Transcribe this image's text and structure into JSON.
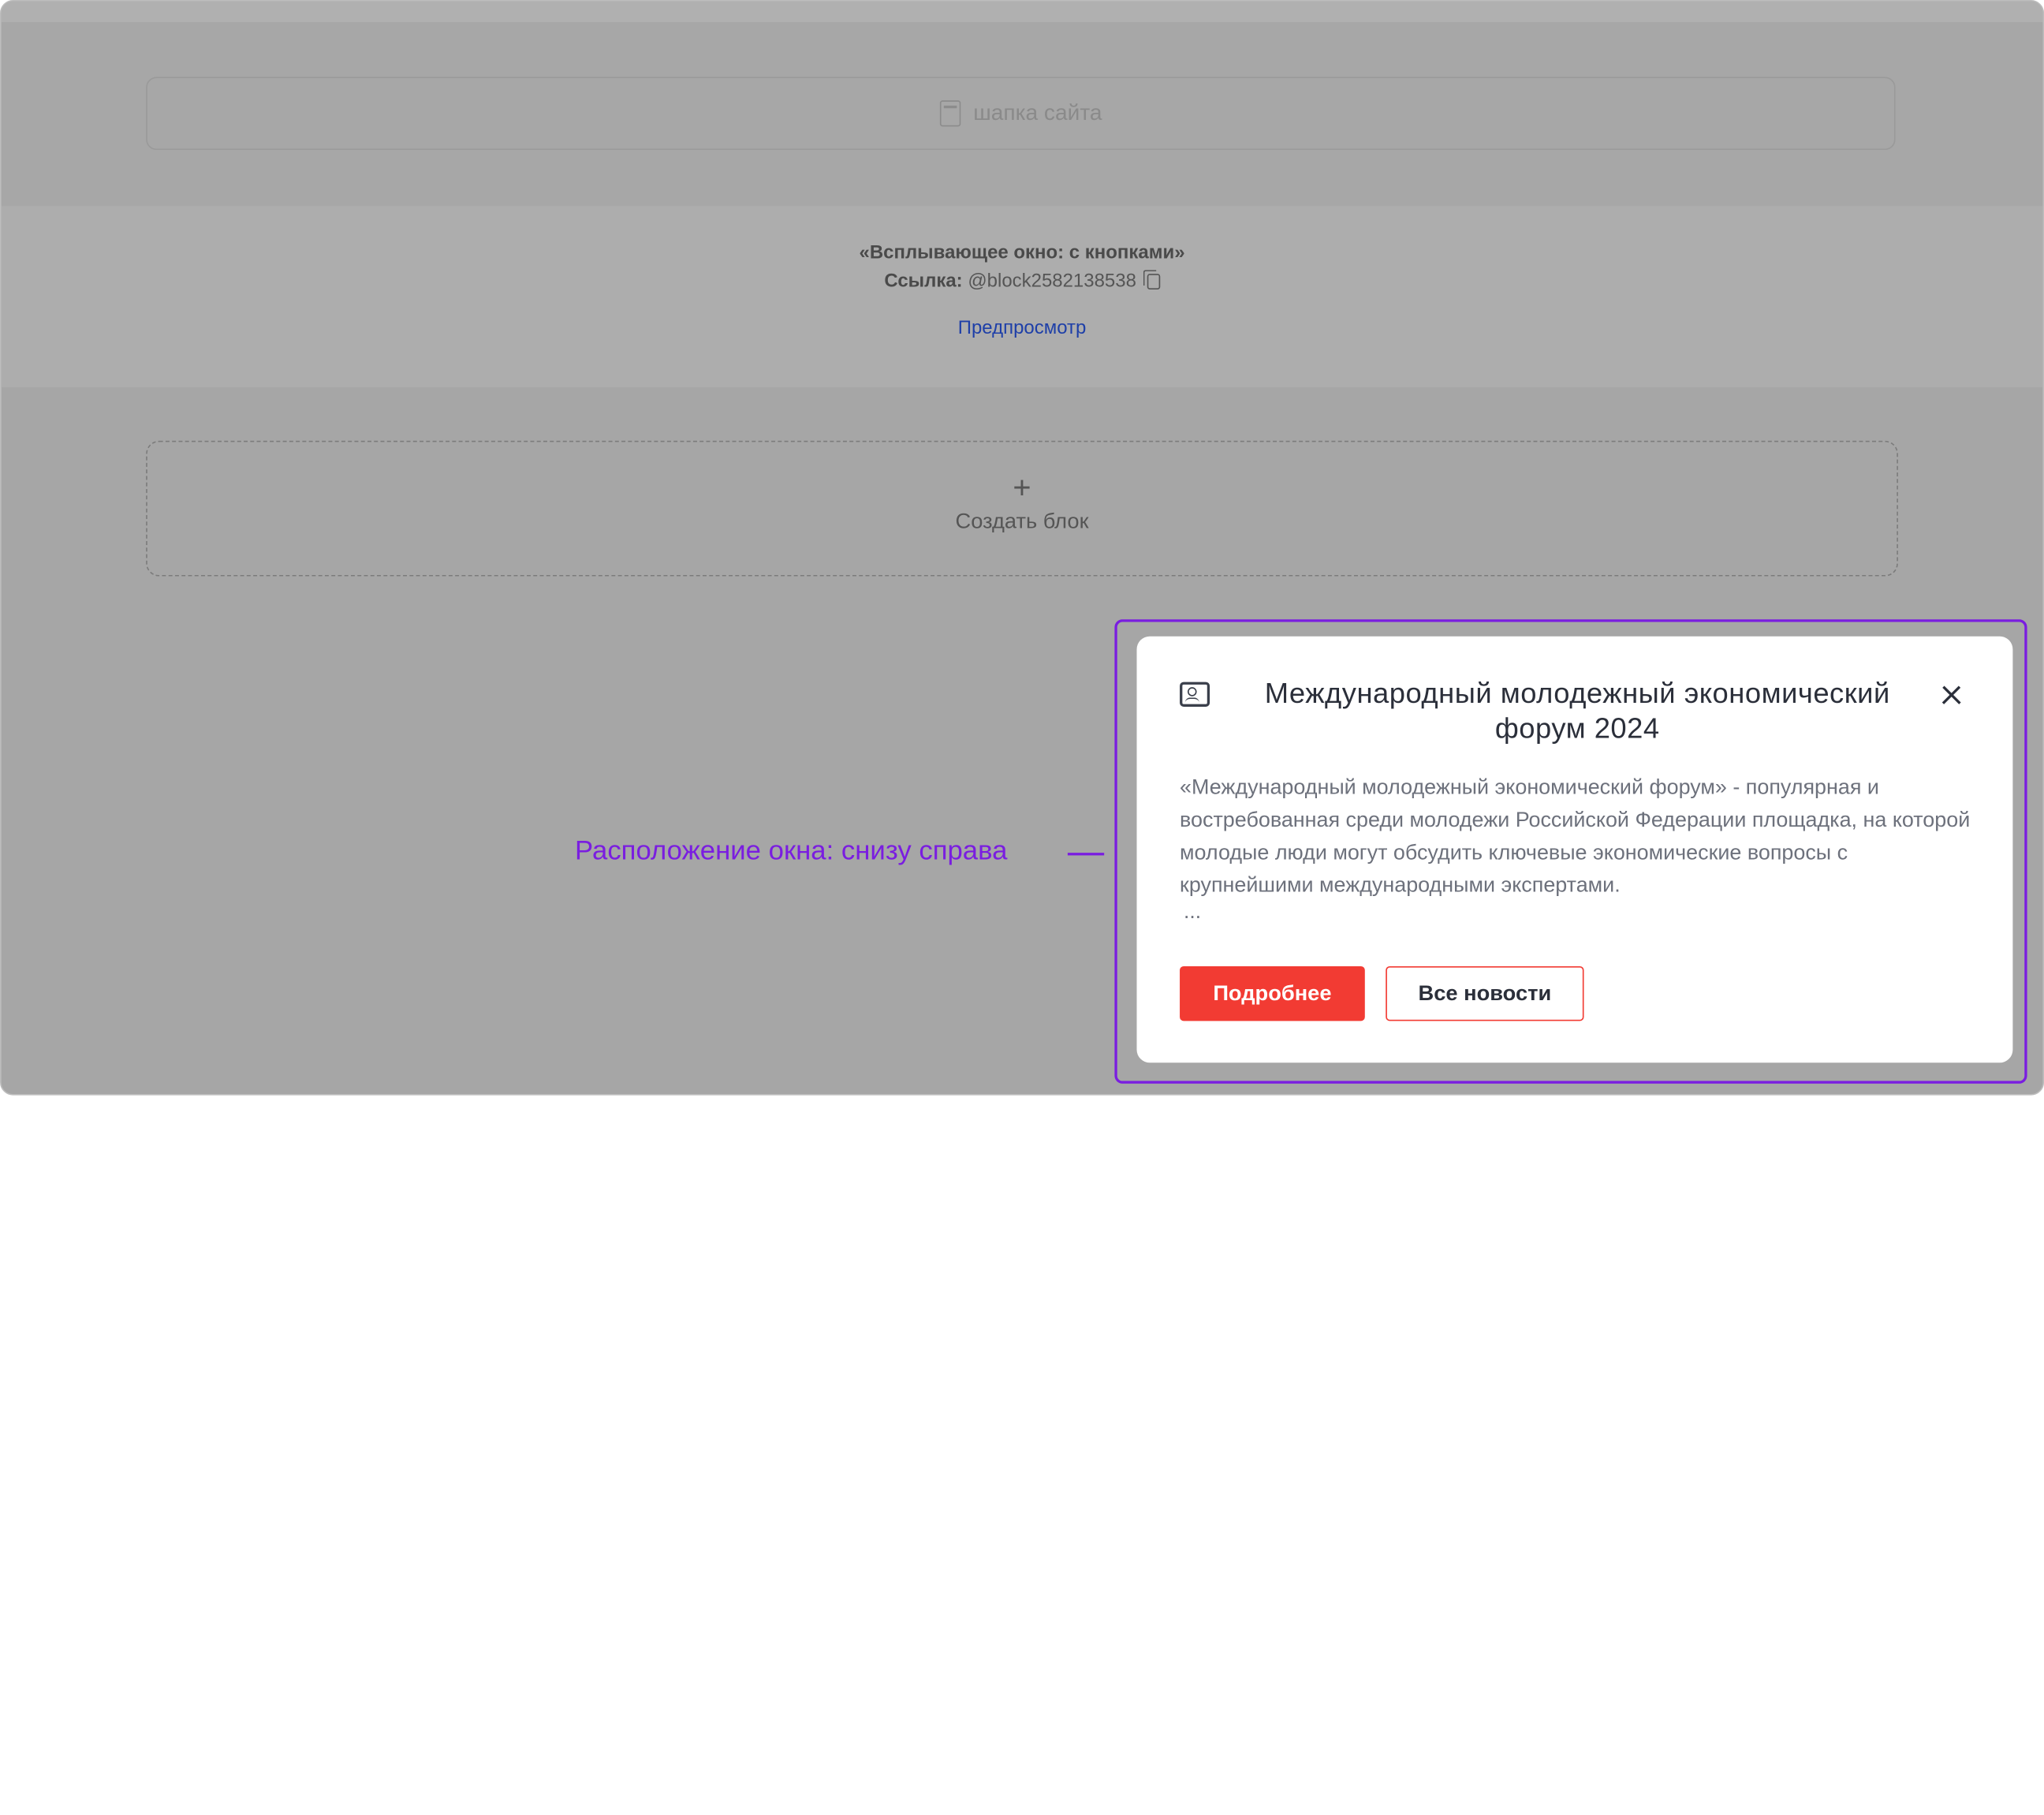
{
  "header_placeholder": {
    "label": "шапка сайта",
    "icon": "page-icon"
  },
  "block_info": {
    "title": "«Всплывающее окно: с кнопками»",
    "link_label": "Ссылка:",
    "link_value": "@block2582138538",
    "copy_icon": "copy-icon",
    "preview_label": "Предпросмотр"
  },
  "create_block": {
    "plus": "+",
    "label": "Создать блок"
  },
  "annotation": {
    "text": "Расположение окна: снизу справа",
    "color": "#7a1de0"
  },
  "popup": {
    "icon": "id-card-icon",
    "title": "Международный молодежный экономический форум 2024",
    "body": "«Международный молодежный экономический форум» - популярная и востребованная среди молодежи Российской Федерации площадка, на которой молодые люди могут обсудить ключевые экономические вопросы с крупнейшими международными экспертами.",
    "ellipsis": "...",
    "primary_button": "Подробнее",
    "secondary_button": "Все новости",
    "accent_color": "#f23b33"
  }
}
